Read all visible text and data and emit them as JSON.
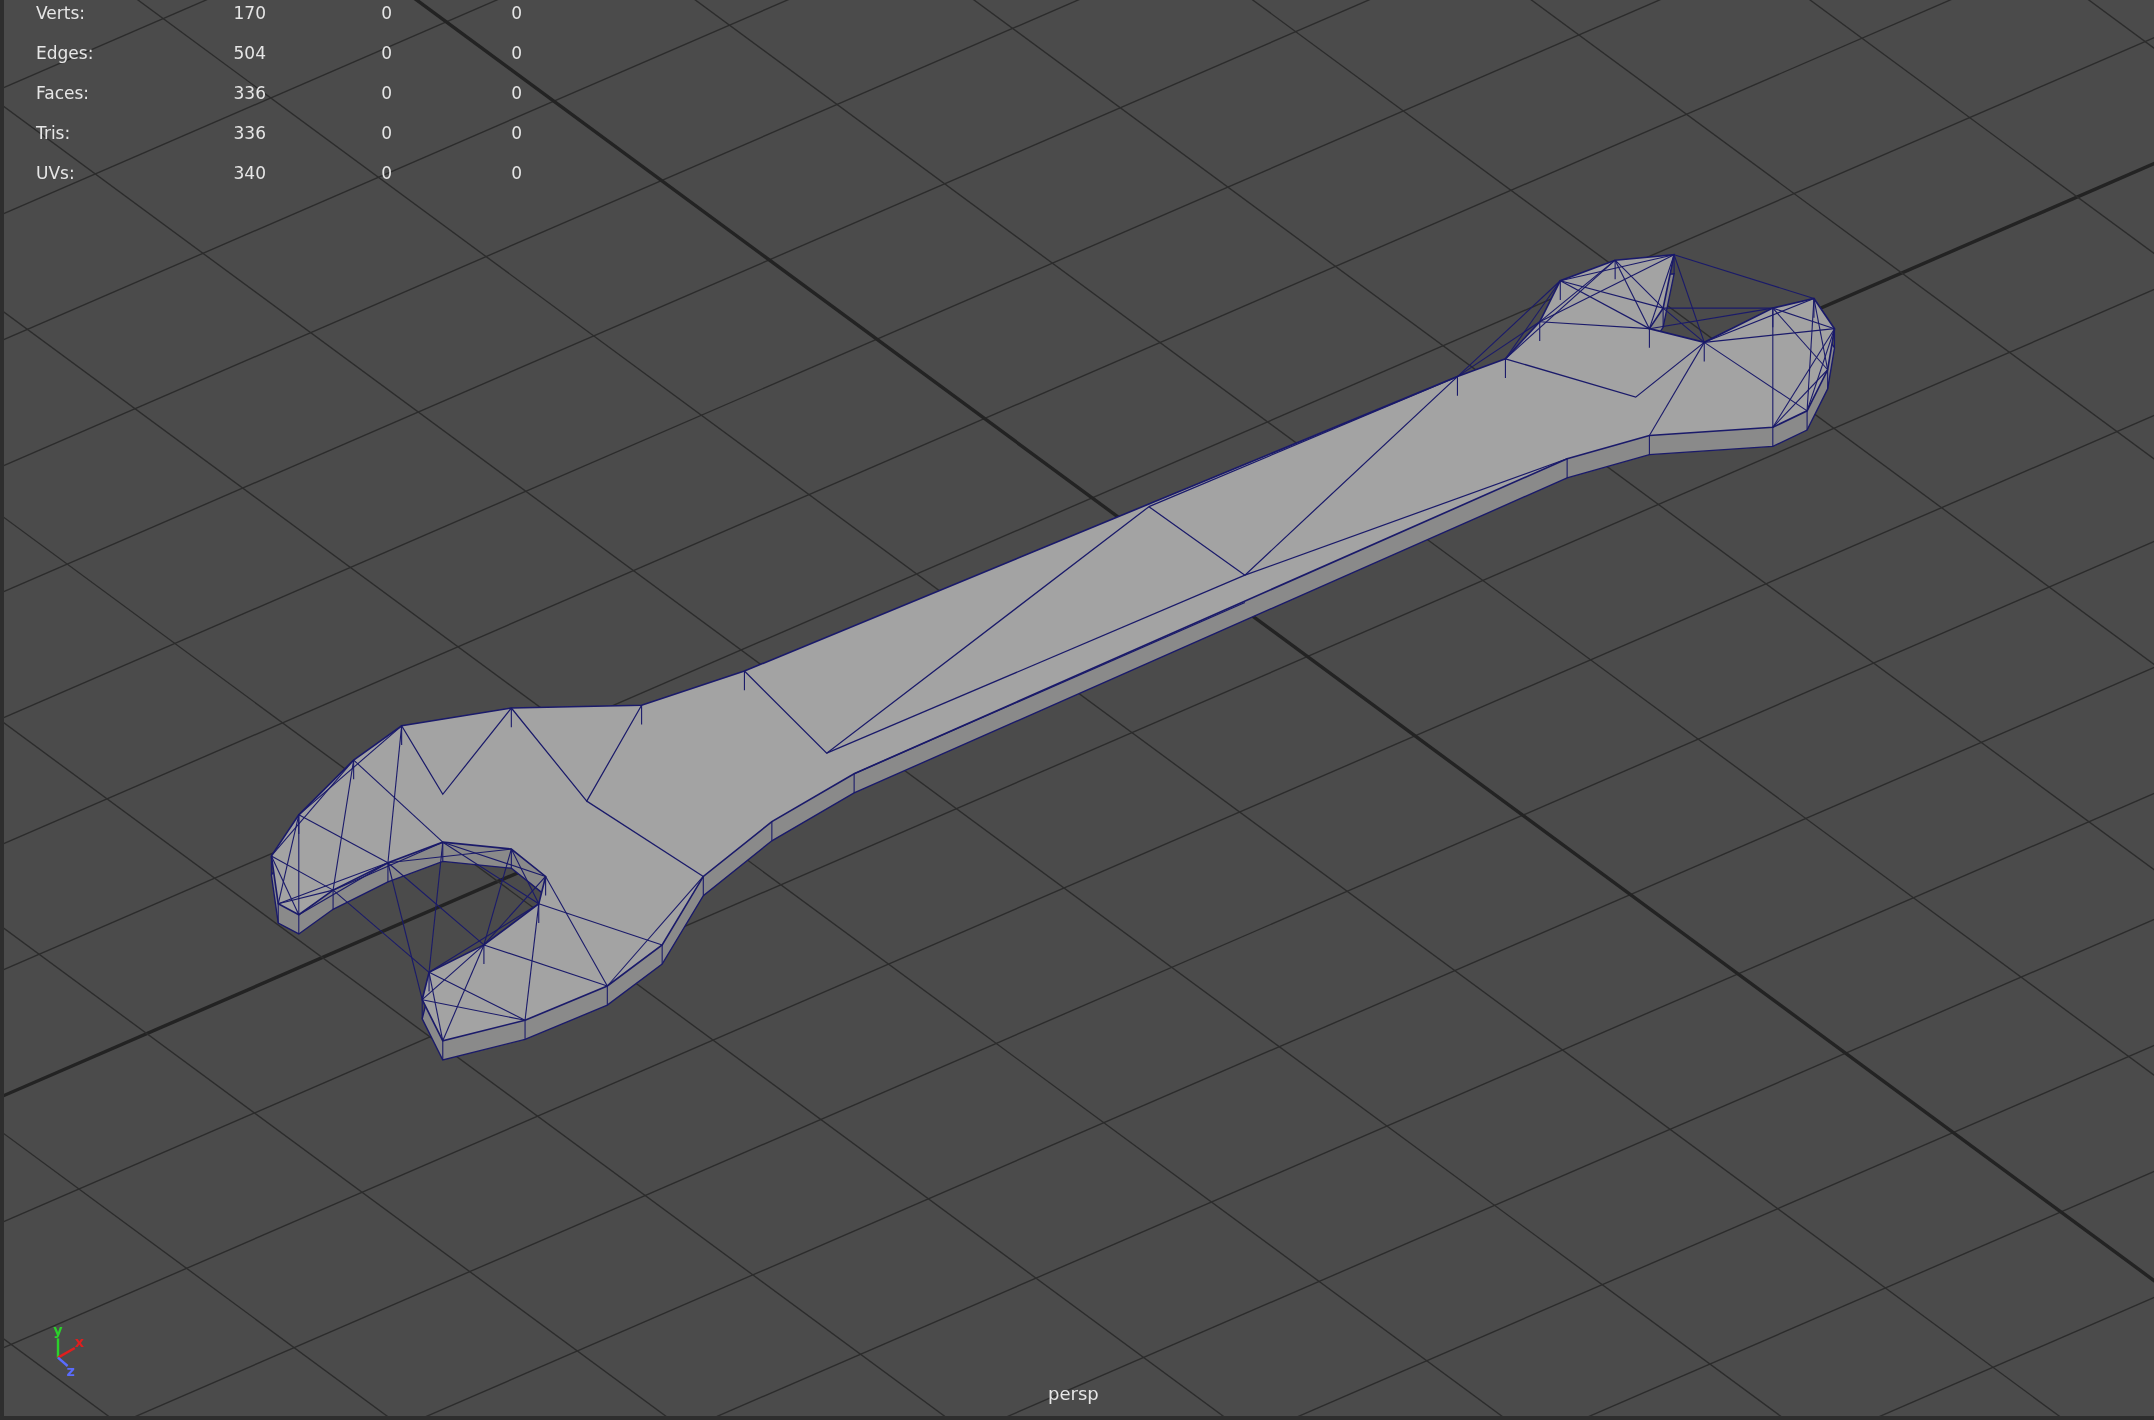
{
  "hud": {
    "rows": [
      {
        "label": "Verts:",
        "values": [
          "170",
          "0",
          "0"
        ]
      },
      {
        "label": "Edges:",
        "values": [
          "504",
          "0",
          "0"
        ]
      },
      {
        "label": "Faces:",
        "values": [
          "336",
          "0",
          "0"
        ]
      },
      {
        "label": "Tris:",
        "values": [
          "336",
          "0",
          "0"
        ]
      },
      {
        "label": "UVs:",
        "values": [
          "340",
          "0",
          "0"
        ]
      }
    ]
  },
  "axes": [
    {
      "label": "y",
      "color": "#2bd12b"
    },
    {
      "label": "x",
      "color": "#e01e1e"
    },
    {
      "label": "z",
      "color": "#5a6cff"
    }
  ],
  "camera": "persp"
}
